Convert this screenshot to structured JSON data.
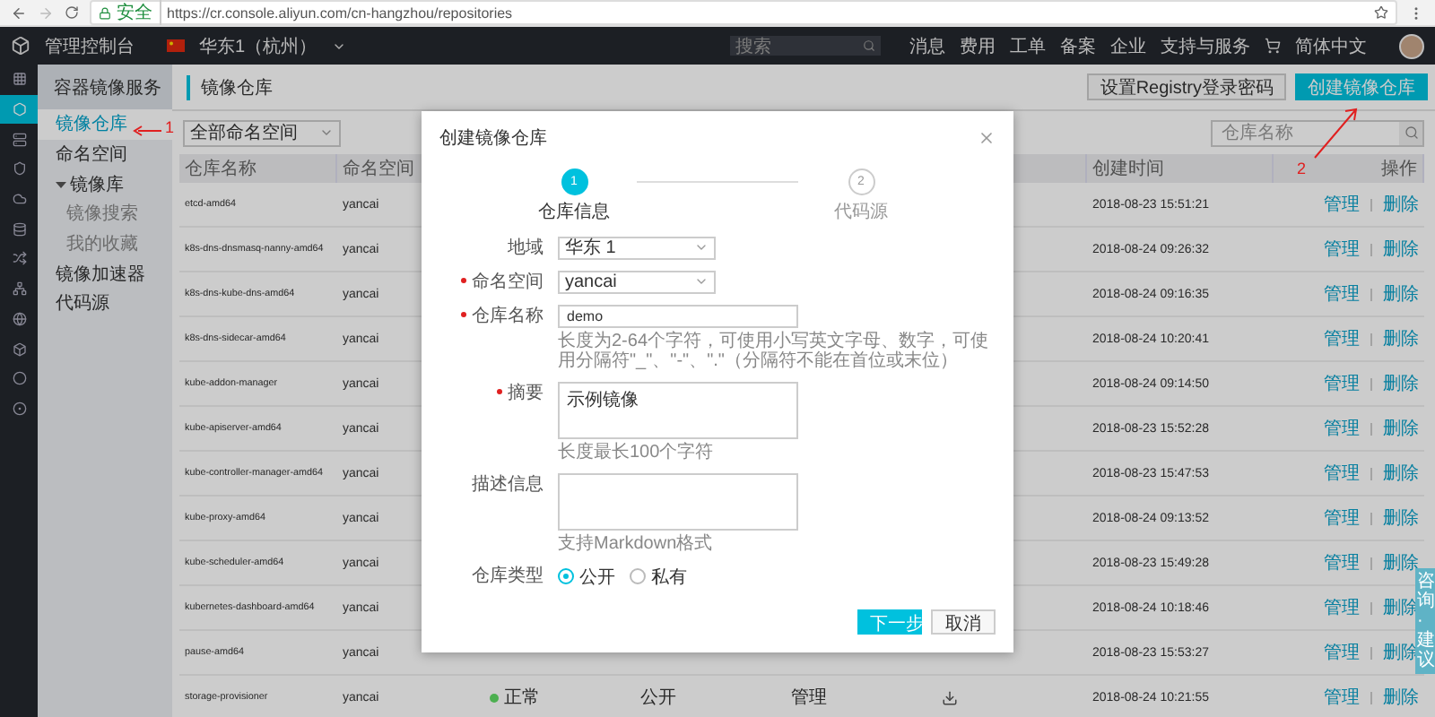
{
  "browser": {
    "security": "安全",
    "url": "https://cr.console.aliyun.com/cn-hangzhou/repositories"
  },
  "topbar": {
    "title": "管理控制台",
    "region": "华东1（杭州）",
    "search_placeholder": "搜索",
    "links": [
      "消息",
      "费用",
      "工单",
      "备案",
      "企业",
      "支持与服务"
    ],
    "language": "简体中文"
  },
  "icon_rail": [
    {
      "selected": false
    },
    {
      "selected": true
    },
    {
      "selected": false
    },
    {
      "selected": false
    },
    {
      "selected": false
    },
    {
      "selected": false
    },
    {
      "selected": false
    },
    {
      "selected": false
    },
    {
      "selected": false
    },
    {
      "selected": false
    },
    {
      "selected": false
    },
    {
      "selected": false
    }
  ],
  "sidebar": {
    "title": "容器镜像服务",
    "items": [
      {
        "label": "镜像仓库",
        "selected": true
      },
      {
        "label": "命名空间",
        "selected": false
      },
      {
        "label": "镜像库",
        "selected": false,
        "expanded": true,
        "children": [
          {
            "label": "镜像搜索",
            "selected": false
          },
          {
            "label": "我的收藏",
            "selected": false
          }
        ]
      },
      {
        "label": "镜像加速器",
        "selected": false
      },
      {
        "label": "代码源",
        "selected": false
      }
    ]
  },
  "page": {
    "title": "镜像仓库",
    "buttons": [
      {
        "label": "设置Registry登录密码",
        "kind": "secondary"
      },
      {
        "label": "创建镜像仓库",
        "kind": "primary"
      }
    ],
    "namespace_filter": "全部命名空间",
    "search_placeholder": "仓库名称"
  },
  "table": {
    "columns": [
      "仓库名称",
      "命名空间",
      "创建时间",
      "操作"
    ],
    "rows": [
      {
        "name": "etcd-amd64",
        "namespace": "yancai",
        "created": "2018-08-23 15:51:21",
        "actions": [
          "管理",
          "删除"
        ]
      },
      {
        "name": "k8s-dns-dnsmasq-nanny-amd64",
        "namespace": "yancai",
        "created": "2018-08-24 09:26:32",
        "actions": [
          "管理",
          "删除"
        ]
      },
      {
        "name": "k8s-dns-kube-dns-amd64",
        "namespace": "yancai",
        "created": "2018-08-24 09:16:35",
        "actions": [
          "管理",
          "删除"
        ]
      },
      {
        "name": "k8s-dns-sidecar-amd64",
        "namespace": "yancai",
        "created": "2018-08-24 10:20:41",
        "actions": [
          "管理",
          "删除"
        ]
      },
      {
        "name": "kube-addon-manager",
        "namespace": "yancai",
        "created": "2018-08-24 09:14:50",
        "actions": [
          "管理",
          "删除"
        ]
      },
      {
        "name": "kube-apiserver-amd64",
        "namespace": "yancai",
        "created": "2018-08-23 15:52:28",
        "actions": [
          "管理",
          "删除"
        ]
      },
      {
        "name": "kube-controller-manager-amd64",
        "namespace": "yancai",
        "created": "2018-08-23 15:47:53",
        "actions": [
          "管理",
          "删除"
        ]
      },
      {
        "name": "kube-proxy-amd64",
        "namespace": "yancai",
        "created": "2018-08-24 09:13:52",
        "actions": [
          "管理",
          "删除"
        ]
      },
      {
        "name": "kube-scheduler-amd64",
        "namespace": "yancai",
        "created": "2018-08-23 15:49:28",
        "actions": [
          "管理",
          "删除"
        ]
      },
      {
        "name": "kubernetes-dashboard-amd64",
        "namespace": "yancai",
        "created": "2018-08-24 10:18:46",
        "actions": [
          "管理",
          "删除"
        ]
      },
      {
        "name": "pause-amd64",
        "namespace": "yancai",
        "created": "2018-08-23 15:53:27",
        "actions": [
          "管理",
          "删除"
        ]
      },
      {
        "name": "storage-provisioner",
        "namespace": "yancai",
        "status": {
          "label": "正常",
          "color": "#4caf50"
        },
        "type": "公开",
        "column_5": "管理",
        "download": true,
        "created": "2018-08-24 10:21:55",
        "actions": [
          "管理",
          "删除"
        ]
      }
    ]
  },
  "annotations": [
    "1",
    "2"
  ],
  "feedback_tab": "咨询·建议",
  "dialog": {
    "title": "创建镜像仓库",
    "steps": [
      {
        "number": "1",
        "label": "仓库信息",
        "active": true
      },
      {
        "number": "2",
        "label": "代码源",
        "active": false
      }
    ],
    "fields": [
      {
        "kind": "select",
        "label": "地域",
        "required": false,
        "value": "华东 1"
      },
      {
        "kind": "select",
        "label": "命名空间",
        "required": true,
        "value": "yancai"
      },
      {
        "kind": "input",
        "label": "仓库名称",
        "required": true,
        "value": "demo",
        "hint": "长度为2-64个字符，可使用小写英文字母、数字，可使用分隔符\"_\"、\"-\"、\".\"（分隔符不能在首位或末位）"
      },
      {
        "kind": "textarea",
        "label": "摘要",
        "required": true,
        "value": "示例镜像",
        "hint": "长度最长100个字符"
      },
      {
        "kind": "textarea",
        "label": "描述信息",
        "required": false,
        "hint": "支持Markdown格式"
      },
      {
        "kind": "radio",
        "label": "仓库类型",
        "required": false,
        "options": [
          {
            "label": "公开",
            "selected": true
          },
          {
            "label": "私有",
            "selected": false
          }
        ]
      }
    ],
    "buttons": [
      {
        "label": "下一步",
        "kind": "primary"
      },
      {
        "label": "取消",
        "kind": "secondary"
      }
    ]
  }
}
